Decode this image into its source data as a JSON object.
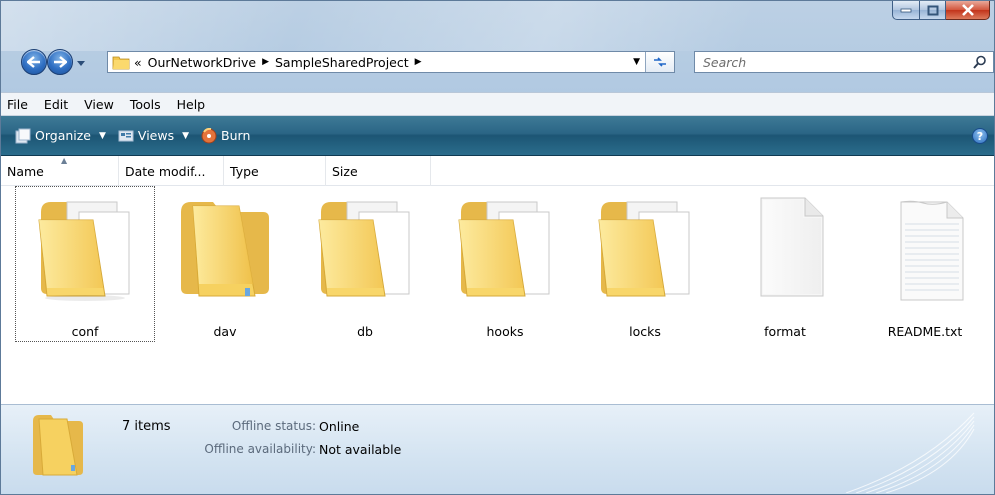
{
  "address": {
    "overflow": "«",
    "crumbs": [
      "OurNetworkDrive",
      "SampleSharedProject"
    ]
  },
  "search": {
    "placeholder": "Search"
  },
  "menu": [
    "File",
    "Edit",
    "View",
    "Tools",
    "Help"
  ],
  "commands": {
    "organize": "Organize",
    "views": "Views",
    "burn": "Burn"
  },
  "columns": {
    "name": "Name",
    "date": "Date modif...",
    "type": "Type",
    "size": "Size"
  },
  "items": [
    {
      "label": "conf",
      "kind": "folder-with-files"
    },
    {
      "label": "dav",
      "kind": "folder-empty"
    },
    {
      "label": "db",
      "kind": "folder-with-files"
    },
    {
      "label": "hooks",
      "kind": "folder-with-files"
    },
    {
      "label": "locks",
      "kind": "folder-with-files"
    },
    {
      "label": "format",
      "kind": "file-generic"
    },
    {
      "label": "README.txt",
      "kind": "file-text"
    }
  ],
  "details": {
    "count": "7 items",
    "offline_status_label": "Offline status:",
    "offline_status_value": "Online",
    "offline_availability_label": "Offline availability:",
    "offline_availability_value": "Not available"
  },
  "colors": {
    "command_bar": "#1c5574",
    "accent": "#2f6fc3",
    "close": "#c2341b"
  }
}
